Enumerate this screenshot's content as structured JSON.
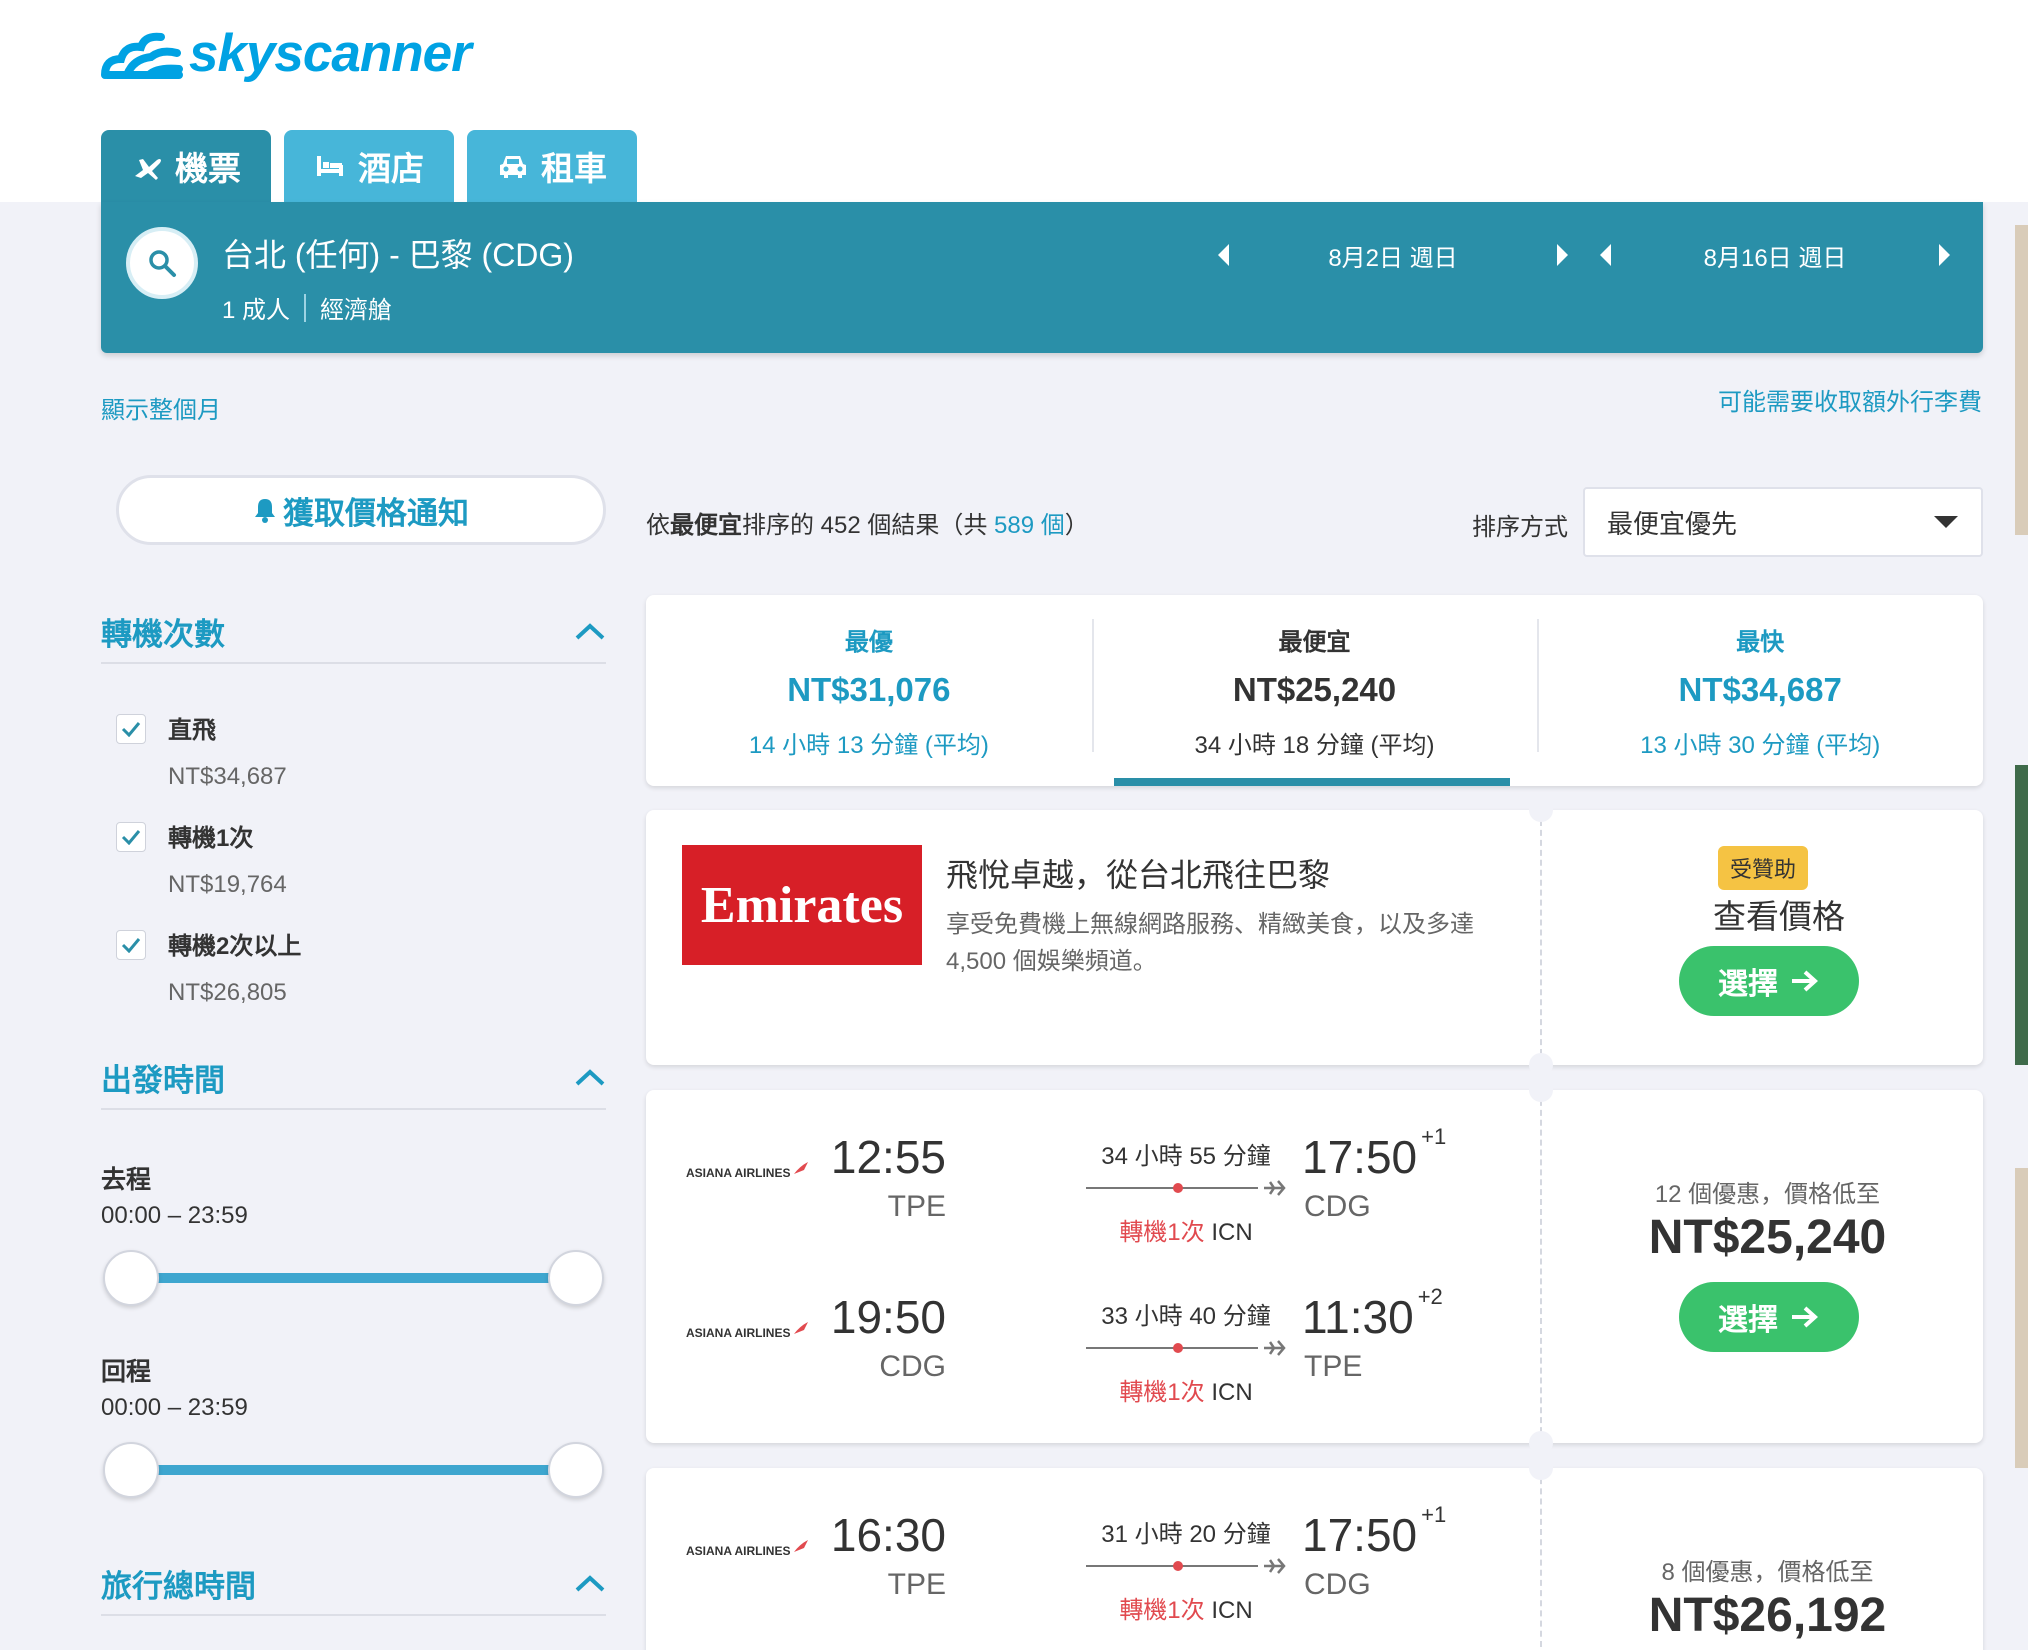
{
  "brand": {
    "name": "skyscanner",
    "color": "#00a2e3"
  },
  "tabs": [
    {
      "label": "機票",
      "icon": "plane-icon",
      "active": true
    },
    {
      "label": "酒店",
      "icon": "bed-icon",
      "active": false
    },
    {
      "label": "租車",
      "icon": "car-icon",
      "active": false
    }
  ],
  "search": {
    "route": "台北 (任何) - 巴黎 (CDG)",
    "passengers": "1 成人",
    "cabin": "經濟艙",
    "depart_date": "8月2日 週日",
    "return_date": "8月16日 週日"
  },
  "links": {
    "whole_month": "顯示整個月",
    "baggage_fees": "可能需要收取額外行李費"
  },
  "price_alert": {
    "label": "獲取價格通知"
  },
  "filters": {
    "stops": {
      "title": "轉機次數",
      "options": [
        {
          "label": "直飛",
          "price": "NT$34,687",
          "checked": true
        },
        {
          "label": "轉機1次",
          "price": "NT$19,764",
          "checked": true
        },
        {
          "label": "轉機2次以上",
          "price": "NT$26,805",
          "checked": true
        }
      ]
    },
    "departure_times": {
      "title": "出發時間",
      "outbound": {
        "label": "去程",
        "range": "00:00 – 23:59"
      },
      "inbound": {
        "label": "回程",
        "range": "00:00 – 23:59"
      }
    },
    "journey_duration": {
      "title": "旅行總時間"
    }
  },
  "results": {
    "prefix": "依",
    "sort_word": "最便宜",
    "middle": "排序的 452 個結果（共 ",
    "total": "589 個",
    "suffix": "）",
    "sort_label": "排序方式",
    "sort_value": "最便宜優先"
  },
  "summary": [
    {
      "title": "最優",
      "price": "NT$31,076",
      "duration": "14 小時 13 分鐘 (平均)",
      "selected": false
    },
    {
      "title": "最便宜",
      "price": "NT$25,240",
      "duration": "34 小時 18 分鐘 (平均)",
      "selected": true
    },
    {
      "title": "最快",
      "price": "NT$34,687",
      "duration": "13 小時 30 分鐘 (平均)",
      "selected": false
    }
  ],
  "ad": {
    "airline_logo_text": "Emirates",
    "title": "飛悅卓越，從台北飛往巴黎",
    "description": "享受免費機上無線網路服務、精緻美食，以及多達 4,500 個娛樂頻道。",
    "badge": "受贊助",
    "cta_text": "查看價格",
    "button": "選擇"
  },
  "flights": [
    {
      "deals": "12 個優惠，價格低至",
      "price": "NT$25,240",
      "button": "選擇",
      "legs": [
        {
          "airline": "ASIANA AIRLINES",
          "dep_time": "12:55",
          "dep_code": "TPE",
          "duration": "34 小時 55 分鐘",
          "stop_text": "轉機1次",
          "stop_airport": "ICN",
          "arr_time": "17:50",
          "day_offset": "+1",
          "arr_code": "CDG"
        },
        {
          "airline": "ASIANA AIRLINES",
          "dep_time": "19:50",
          "dep_code": "CDG",
          "duration": "33 小時 40 分鐘",
          "stop_text": "轉機1次",
          "stop_airport": "ICN",
          "arr_time": "11:30",
          "day_offset": "+2",
          "arr_code": "TPE"
        }
      ]
    },
    {
      "deals": "8 個優惠，價格低至",
      "price": "NT$26,192",
      "legs": [
        {
          "airline": "ASIANA AIRLINES",
          "dep_time": "16:30",
          "dep_code": "TPE",
          "duration": "31 小時 20 分鐘",
          "stop_text": "轉機1次",
          "stop_airport": "ICN",
          "arr_time": "17:50",
          "day_offset": "+1",
          "arr_code": "CDG"
        }
      ]
    }
  ],
  "colors": {
    "header_teal": "#2a8fa8",
    "tab_blue": "#47b6d9",
    "link_blue": "#1d9ac2",
    "select_green": "#3ac26c",
    "stop_red": "#e14a4f",
    "badge_yellow": "#f5c343",
    "emirates_red": "#d71f27"
  }
}
